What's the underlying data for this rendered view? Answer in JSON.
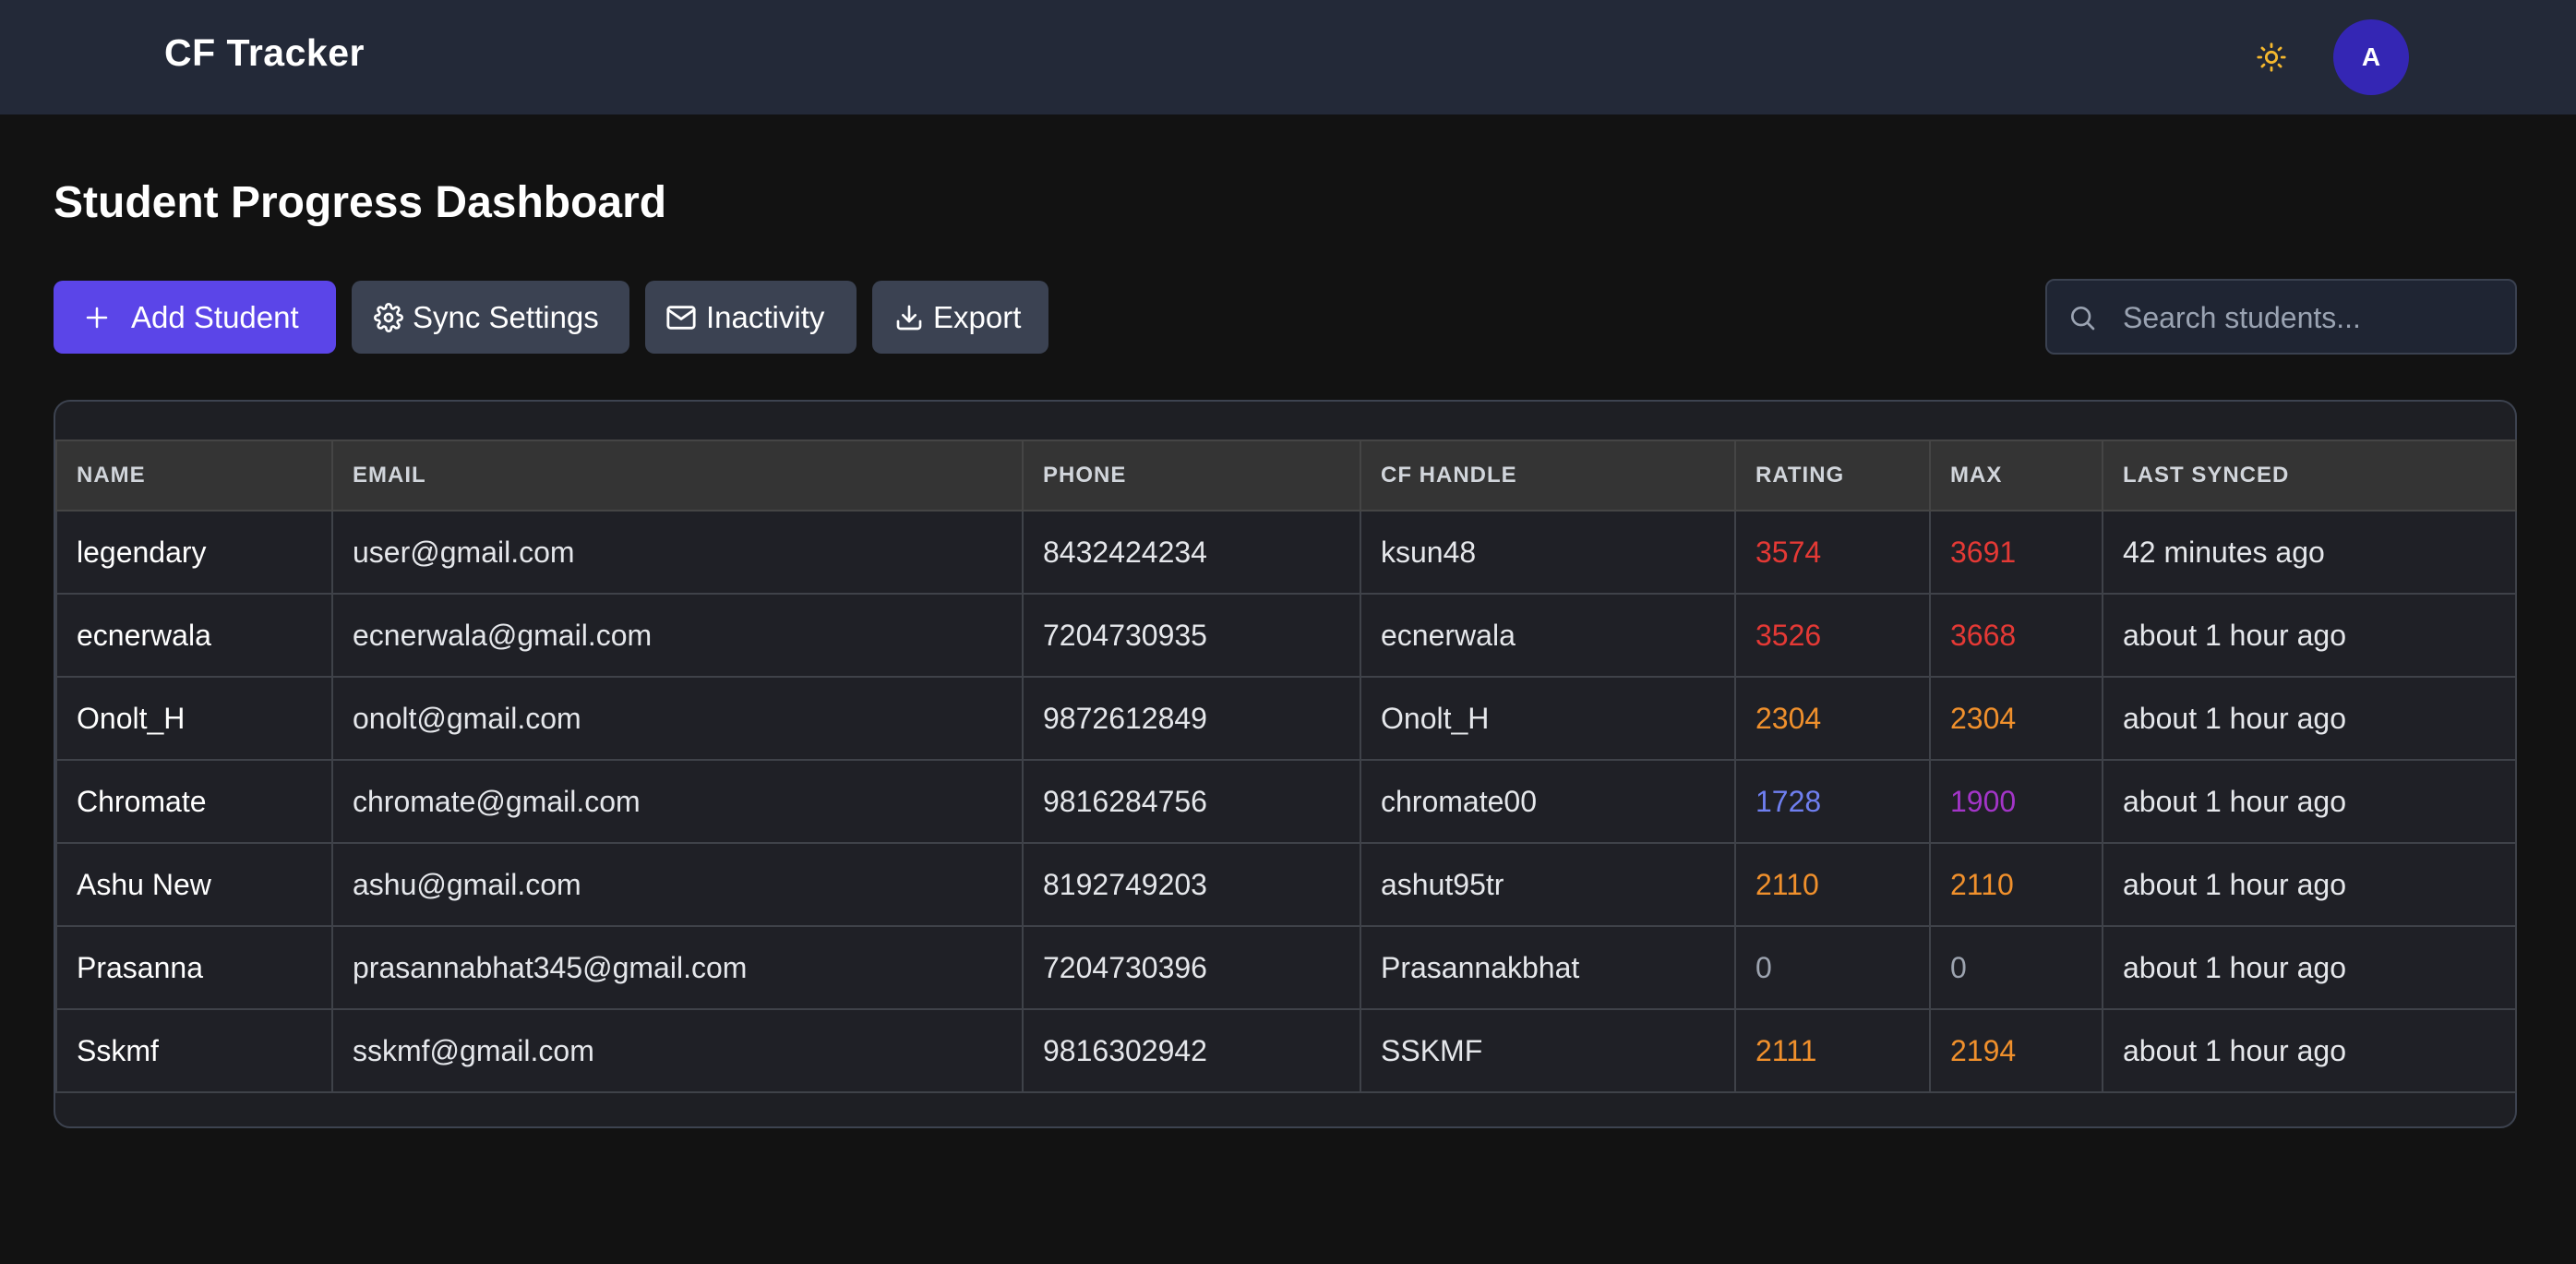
{
  "navbar": {
    "brand": "CF Tracker",
    "theme_icon": "sun-icon",
    "avatar_initial": "A"
  },
  "page": {
    "title": "Student Progress Dashboard"
  },
  "toolbar": {
    "add_student": "Add Student",
    "sync_settings": "Sync Settings",
    "inactivity": "Inactivity",
    "export": "Export"
  },
  "search": {
    "placeholder": "Search students...",
    "value": ""
  },
  "colors": {
    "accent": "#5b45e8",
    "red": "#e53935",
    "orange": "#f0902c",
    "blue": "#6f7ff0",
    "purple": "#a335c8",
    "gray": "#9ca3af"
  },
  "table": {
    "headers": [
      "NAME",
      "EMAIL",
      "PHONE",
      "CF HANDLE",
      "RATING",
      "MAX",
      "LAST SYNCED"
    ],
    "rows": [
      {
        "name": "legendary",
        "email": "user@gmail.com",
        "phone": "8432424234",
        "handle": "ksun48",
        "rating": "3574",
        "max": "3691",
        "last_synced": "42 minutes ago"
      },
      {
        "name": "ecnerwala",
        "email": "ecnerwala@gmail.com",
        "phone": "7204730935",
        "handle": "ecnerwala",
        "rating": "3526",
        "max": "3668",
        "last_synced": "about 1 hour ago"
      },
      {
        "name": "Onolt_H",
        "email": "onolt@gmail.com",
        "phone": "9872612849",
        "handle": "Onolt_H",
        "rating": "2304",
        "max": "2304",
        "last_synced": "about 1 hour ago"
      },
      {
        "name": "Chromate",
        "email": "chromate@gmail.com",
        "phone": "9816284756",
        "handle": "chromate00",
        "rating": "1728",
        "max": "1900",
        "last_synced": "about 1 hour ago"
      },
      {
        "name": "Ashu New",
        "email": "ashu@gmail.com",
        "phone": "8192749203",
        "handle": "ashut95tr",
        "rating": "2110",
        "max": "2110",
        "last_synced": "about 1 hour ago"
      },
      {
        "name": "Prasanna",
        "email": "prasannabhat345@gmail.com",
        "phone": "7204730396",
        "handle": "Prasannakbhat",
        "rating": "0",
        "max": "0",
        "last_synced": "about 1 hour ago"
      },
      {
        "name": "Sskmf",
        "email": "sskmf@gmail.com",
        "phone": "9816302942",
        "handle": "SSKMF",
        "rating": "2111",
        "max": "2194",
        "last_synced": "about 1 hour ago"
      }
    ]
  }
}
